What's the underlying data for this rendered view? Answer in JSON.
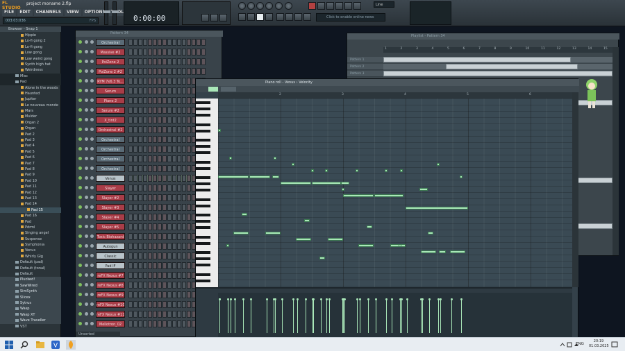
{
  "app": {
    "logo": "FL STUDIO",
    "title": "project moname 2.flp",
    "menu": [
      "FILE",
      "EDIT",
      "CHANNELS",
      "VIEW",
      "OPTIONS",
      "TOOLS",
      "HELP"
    ],
    "hint_left": "003:03:036",
    "hint_right": "FPS",
    "time": "0:00:00",
    "snap": "Line",
    "online": "Click to enable online news"
  },
  "browser": {
    "header": "Browser - Snap 1",
    "items": [
      {
        "label": "Hippie",
        "cls": "lvl1"
      },
      {
        "label": "Lo-fi gong 2",
        "cls": "lvl1"
      },
      {
        "label": "Lo-fi gong",
        "cls": "lvl1"
      },
      {
        "label": "Low gong",
        "cls": "lvl1"
      },
      {
        "label": "Low weird gong",
        "cls": "lvl1"
      },
      {
        "label": "Synth high hat",
        "cls": "lvl1"
      },
      {
        "label": "Weirdness",
        "cls": "lvl1"
      },
      {
        "label": "Misc",
        "cls": "lvl0 sel"
      },
      {
        "label": "Pad",
        "cls": "lvl0 sel"
      },
      {
        "label": "Alone in the woods",
        "cls": "lvl1"
      },
      {
        "label": "Haunted",
        "cls": "lvl1"
      },
      {
        "label": "Jupiter",
        "cls": "lvl1"
      },
      {
        "label": "Le nouveau monde",
        "cls": "lvl1"
      },
      {
        "label": "Mars",
        "cls": "lvl1"
      },
      {
        "label": "Mulder",
        "cls": "lvl1"
      },
      {
        "label": "Organ 2",
        "cls": "lvl1"
      },
      {
        "label": "Organ",
        "cls": "lvl1"
      },
      {
        "label": "Pad 2",
        "cls": "lvl1"
      },
      {
        "label": "Pad 3",
        "cls": "lvl1"
      },
      {
        "label": "Pad 4",
        "cls": "lvl1"
      },
      {
        "label": "Pad 5",
        "cls": "lvl1"
      },
      {
        "label": "Pad 6",
        "cls": "lvl1"
      },
      {
        "label": "Pad 7",
        "cls": "lvl1"
      },
      {
        "label": "Pad 8",
        "cls": "lvl1"
      },
      {
        "label": "Pad 9",
        "cls": "lvl1"
      },
      {
        "label": "Pad 10",
        "cls": "lvl1"
      },
      {
        "label": "Pad 11",
        "cls": "lvl1"
      },
      {
        "label": "Pad 12",
        "cls": "lvl1"
      },
      {
        "label": "Pad 13",
        "cls": "lvl1"
      },
      {
        "label": "Pad 14",
        "cls": "lvl1"
      },
      {
        "label": "Pad 15",
        "cls": "sub hl"
      },
      {
        "label": "Pad 16",
        "cls": "lvl1"
      },
      {
        "label": "Pad",
        "cls": "lvl1"
      },
      {
        "label": "Pdrml",
        "cls": "lvl1"
      },
      {
        "label": "Singing angel",
        "cls": "lvl1"
      },
      {
        "label": "Suspense",
        "cls": "lvl1"
      },
      {
        "label": "Symphonia",
        "cls": "lvl1"
      },
      {
        "label": "Venus",
        "cls": "lvl1"
      },
      {
        "label": "Whirly Gig",
        "cls": "lvl1"
      },
      {
        "label": "Default (pad)",
        "cls": "lvl0"
      },
      {
        "label": "Default (tonal)",
        "cls": "lvl0"
      },
      {
        "label": "Default",
        "cls": "lvl0"
      },
      {
        "label": "Plucked!",
        "cls": "plug"
      },
      {
        "label": "SawWired",
        "cls": "plug"
      },
      {
        "label": "SimSynth",
        "cls": "plug"
      },
      {
        "label": "Slicex",
        "cls": "plug"
      },
      {
        "label": "Sytrus",
        "cls": "plug"
      },
      {
        "label": "Wasp",
        "cls": "plug"
      },
      {
        "label": "Wasp XT",
        "cls": "plug"
      },
      {
        "label": "Wave Traveller",
        "cls": "plug"
      },
      {
        "label": "VST",
        "cls": "lvl0"
      }
    ]
  },
  "rack": {
    "title": "Pattern 34",
    "footer": "Unsorted",
    "channels": [
      {
        "name": "Orchestral",
        "style": "blue"
      },
      {
        "name": "Massive #2",
        "style": "red"
      },
      {
        "name": "PoiZone 2",
        "style": "red"
      },
      {
        "name": "PoiZone 2 #2",
        "style": "red"
      },
      {
        "name": "RYM 7x6.3 To...",
        "style": "red"
      },
      {
        "name": "Serum",
        "style": "red"
      },
      {
        "name": "Piano 2",
        "style": "red"
      },
      {
        "name": "Serum #2",
        "style": "red"
      },
      {
        "name": "X_tint2",
        "style": "red"
      },
      {
        "name": "Orchestral #2",
        "style": "red"
      },
      {
        "name": "Orchestral",
        "style": "blue"
      },
      {
        "name": "Orchestral",
        "style": "blue"
      },
      {
        "name": "Orchestral",
        "style": "blue"
      },
      {
        "name": "Orchestral",
        "style": "blue"
      },
      {
        "name": "Venus",
        "style": "light"
      },
      {
        "name": "Slayer",
        "style": "red"
      },
      {
        "name": "Slayer #2",
        "style": "red"
      },
      {
        "name": "Slayer #3",
        "style": "red"
      },
      {
        "name": "Slayer #4",
        "style": "red"
      },
      {
        "name": "Slayer #5",
        "style": "red"
      },
      {
        "name": "Toxic Biohazard",
        "style": "red"
      },
      {
        "name": "Autogun",
        "style": "light"
      },
      {
        "name": "Classic",
        "style": "light"
      },
      {
        "name": "Pad IF",
        "style": "light"
      },
      {
        "name": "reFX Nexus #7",
        "style": "red"
      },
      {
        "name": "reFX Nexus #8",
        "style": "red"
      },
      {
        "name": "reFX Nexus #9",
        "style": "red"
      },
      {
        "name": "reFX Nexus #10",
        "style": "red"
      },
      {
        "name": "reFX Nexus #11",
        "style": "red"
      },
      {
        "name": "Mellotron_02",
        "style": "red"
      }
    ]
  },
  "playlist": {
    "title": "Playlist - Pattern 34",
    "ticks": [
      "1",
      "2",
      "3",
      "4",
      "5",
      "6",
      "7",
      "8",
      "9",
      "10",
      "11",
      "12",
      "13",
      "14",
      "15"
    ],
    "tracks": [
      {
        "label": "Pattern 1"
      },
      {
        "label": "Pattern 2"
      },
      {
        "label": "Pattern 3"
      }
    ]
  },
  "pianoroll": {
    "title": "Piano roll - Venus",
    "target": "Velocity",
    "ticks": [
      "2",
      "3",
      "4",
      "5",
      "6"
    ]
  },
  "taskbar": {
    "lang": "ENG",
    "time": "20:19",
    "date": "01.03.2025"
  }
}
